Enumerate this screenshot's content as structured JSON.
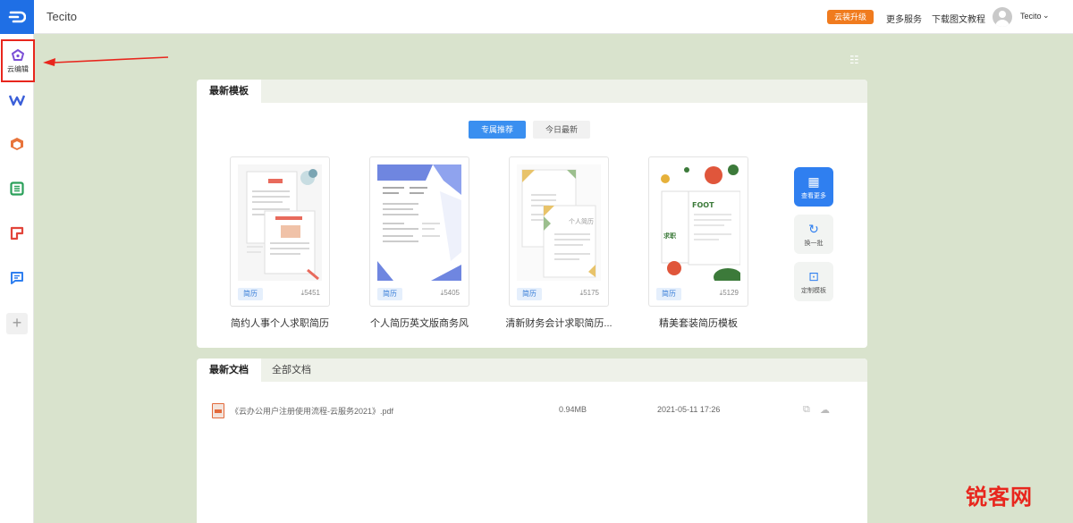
{
  "topbar": {
    "title": "Tecito",
    "upgrade": "云装升级",
    "more_services": "更多服务",
    "tutorial": "下载图文教程",
    "username": "Tecito",
    "caret": "⌄"
  },
  "sidebar": {
    "items": [
      {
        "icon": "cloud-edit-icon",
        "label": "云编辑",
        "color": "#7b4fd6"
      },
      {
        "icon": "wps-writer-icon",
        "label": "",
        "color": "#3b5fd8"
      },
      {
        "icon": "cube-icon",
        "label": "",
        "color": "#e8743b"
      },
      {
        "icon": "sheet-icon",
        "label": "",
        "color": "#2aa05a"
      },
      {
        "icon": "slides-icon",
        "label": "",
        "color": "#e2443a"
      },
      {
        "icon": "chat-icon",
        "label": "",
        "color": "#2f7ff0"
      }
    ],
    "add": "+"
  },
  "templates": {
    "tab_label": "最新模板",
    "toggle_recommend": "专属推荐",
    "toggle_today": "今日最新",
    "cards": [
      {
        "title": "简约人事个人求职简历",
        "tag": "简历",
        "downloads": "5451"
      },
      {
        "title": "个人简历英文版商务风",
        "tag": "简历",
        "downloads": "5405"
      },
      {
        "title": "清新财务会计求职简历...",
        "tag": "简历",
        "downloads": "5175"
      },
      {
        "title": "精美套装简历模板",
        "tag": "简历",
        "downloads": "5129"
      }
    ],
    "actions": {
      "view_more": "查看更多",
      "refresh": "换一批",
      "custom": "定制模板"
    }
  },
  "documents": {
    "tab_recent": "最新文档",
    "tab_all": "全部文档",
    "rows": [
      {
        "name": "《云办公用户注册使用流程-云服务2021》.pdf",
        "size": "0.94MB",
        "date": "2021-05-11 17:26"
      }
    ]
  },
  "watermark": "锐客网",
  "colors": {
    "accent": "#2f7ff0",
    "upgrade": "#f07b1e",
    "background": "#d9e3cd",
    "highlight": "#e8261d"
  }
}
